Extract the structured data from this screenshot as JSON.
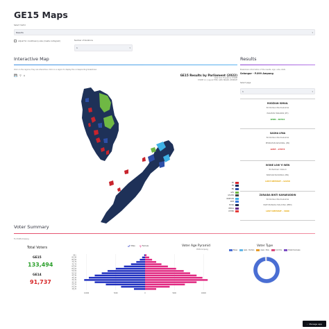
{
  "app": {
    "title": "GE15 Maps",
    "manage_label": "Manage app"
  },
  "controls": {
    "metric_label": "Select metric",
    "metric_value": "Results",
    "checkbox_label": "Adjust for constituency size (create cartogram)",
    "iterations_label": "Number of iterations",
    "iterations_value": "1"
  },
  "map": {
    "heading": "Interactive Map",
    "hint": "Click on the regions; they are interactive. Click on a region to display the corresponding breakdown",
    "chart_title": "GE15 Results by Parliament (2022)",
    "chart_sub1": "Data from Thevesh & STOMP",
    "chart_sub2": "STOMP 1.1 | Layout TMM, GDM, BRAND, RESERVE",
    "legend": [
      {
        "label": "PH",
        "color": "#d7262c"
      },
      {
        "label": "PN",
        "color": "#1a2c5a"
      },
      {
        "label": "BN",
        "color": "#2d4fa8"
      },
      {
        "label": "GPS",
        "color": "#6fb844"
      },
      {
        "label": "GTA/MK",
        "color": "#444444"
      },
      {
        "label": "WARISAN",
        "color": "#39b1e6"
      },
      {
        "label": "KDM",
        "color": "#3a7be0"
      },
      {
        "label": "MUDA",
        "color": "#1f2b4f"
      },
      {
        "label": "BEBAS",
        "color": "#6a2a8a"
      },
      {
        "label": "OTHER",
        "color": "#e33939"
      }
    ],
    "colors": {
      "base": "#1e3158",
      "ph": "#c8242d",
      "gps": "#6fb844",
      "warisan": "#3fb1e5",
      "bn": "#2d4fa8"
    }
  },
  "results": {
    "heading": "Results",
    "hint": "Breakdown information of the results, sign, vote, stats",
    "seat_title": "Selangor - P.099 Ampang",
    "select_label": "Select page",
    "select_value": "1",
    "candidates": [
      {
        "name": "RODZIAN ISMAIL",
        "votes": "84 Pemberi Bermaksimal",
        "party": "PAKATAN HARAPAN (PH)",
        "result": "WON - 66794",
        "result_color": "#2ca02c"
      },
      {
        "name": "SASHA LYNA",
        "votes": "84 Pemberi Bermaksimal",
        "party": "PERIKATAN NASIONAL (PN)",
        "result": "LOST - 27074",
        "result_color": "#d62728"
      },
      {
        "name": "IVONE LOW YI WEN",
        "votes": "84 Pemberi Cikkudi",
        "party": "BARISAN NASIONAL (BN)",
        "result": "LOST DEPOSIT - 12240",
        "result_color": "#e6a500"
      },
      {
        "name": "ZURAIDA BINTI KAMARUDDIN",
        "votes": "84 Pemberi Bermaksimal",
        "party": "PARTI BANGSA MALAYSIA (PBM)",
        "result": "LOST DEPOSIT - 3000",
        "result_color": "#e6a500"
      }
    ]
  },
  "summary": {
    "heading": "Voter Summary",
    "hint": "For P.099 Ampang",
    "total_voters_label": "Total Voters",
    "ge15_label": "GE15",
    "ge15_value": "133,494",
    "ge15_color": "#2ca02c",
    "ge14_label": "GE14",
    "ge14_value": "91,737",
    "ge14_color": "#d62728"
  },
  "chart_data": [
    {
      "type": "bar",
      "title": "Voter Age Pyramid",
      "subtitle": "P099 Ampang",
      "categories": [
        "90+",
        "85_89",
        "80_84",
        "75_79",
        "70_74",
        "65_69",
        "60_64",
        "55_59",
        "50_54",
        "45_49",
        "40_44",
        "35_39",
        "30_34",
        "25_29",
        "21_24",
        "18_20"
      ],
      "series": [
        {
          "name": "Male",
          "color": "#1f2fbf",
          "values": [
            -150,
            -500,
            -900,
            -1500,
            -2400,
            -3600,
            -5000,
            -6400,
            -7400,
            -8600,
            -9600,
            -10400,
            -8600,
            -6700,
            -4100,
            -1900
          ]
        },
        {
          "name": "Female",
          "color": "#e02881",
          "values": [
            250,
            700,
            1200,
            1900,
            2800,
            3900,
            5300,
            6600,
            7700,
            8800,
            9800,
            10700,
            8800,
            6800,
            4200,
            1900
          ]
        }
      ],
      "xticks": [
        "10000",
        "5000",
        "0",
        "5000",
        "10000"
      ],
      "xlim": [
        -11500,
        11500
      ]
    },
    {
      "type": "pie",
      "title": "Voter Type",
      "legend": [
        {
          "label": "Biasa",
          "color": "#4a6ed3"
        },
        {
          "label": "Awal - Tentera",
          "color": "#63b7e8"
        },
        {
          "label": "Awal - Polis",
          "color": "#e69b28"
        },
        {
          "label": "Undi Pos",
          "color": "#d94a7a"
        },
        {
          "label": "Postal Overseas",
          "color": "#7c4fc4"
        }
      ],
      "values": [
        98.3,
        0.7,
        0.4,
        0.4,
        0.2
      ],
      "colors": [
        "#4a6ed3",
        "#63b7e8",
        "#e69b28",
        "#d94a7a",
        "#7c4fc4"
      ]
    }
  ]
}
